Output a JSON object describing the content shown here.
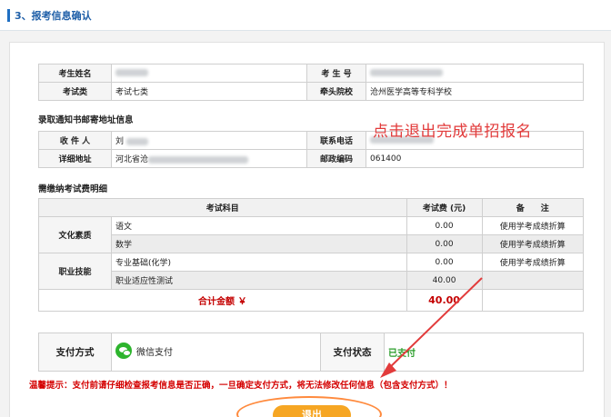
{
  "section": {
    "title": "3、报考信息确认"
  },
  "info": {
    "name_label": "考生姓名",
    "exam_no_label": "考 生 号",
    "exam_type_label": "考试类",
    "exam_type_value": "考试七类",
    "school_label": "牵头院校",
    "school_value": "沧州医学高等专科学校"
  },
  "mailing": {
    "heading": "录取通知书邮寄地址信息",
    "recipient_label": "收 件 人",
    "recipient_value": "刘",
    "phone_label": "联系电话",
    "address_label": "详细地址",
    "address_value": "河北省沧",
    "zip_label": "邮政编码",
    "zip_value": "061400"
  },
  "fees": {
    "heading": "需缴纳考试费明细",
    "col_subject": "考试科目",
    "col_fee": "考试费 (元)",
    "col_note": "备　　注",
    "groups": [
      {
        "name": "文化素质"
      },
      {
        "name": "职业技能"
      }
    ],
    "rows": [
      {
        "subject": "语文",
        "fee": "0.00",
        "note": "使用学考成绩折算"
      },
      {
        "subject": "数学",
        "fee": "0.00",
        "note": "使用学考成绩折算"
      },
      {
        "subject": "专业基础(化学)",
        "fee": "0.00",
        "note": "使用学考成绩折算"
      },
      {
        "subject": "职业适应性测试",
        "fee": "40.00",
        "note": ""
      }
    ],
    "total_label": "合计金额 ￥",
    "total_value": "40.00"
  },
  "payment": {
    "method_label": "支付方式",
    "method_value": "微信支付",
    "method_icon": "wechat-pay-icon",
    "status_label": "支付状态",
    "status_value": "已支付"
  },
  "annotation": "点击退出完成单招报名",
  "warning": "温馨提示：支付前请仔细检查报考信息是否正确，一旦确定支付方式，将无法修改任何信息（包含支付方式）！",
  "exit_button": "退出",
  "colors": {
    "accent": "#1f6fc2",
    "alert": "#d40000",
    "success": "#2a9d2a",
    "button": "#f6a623"
  }
}
